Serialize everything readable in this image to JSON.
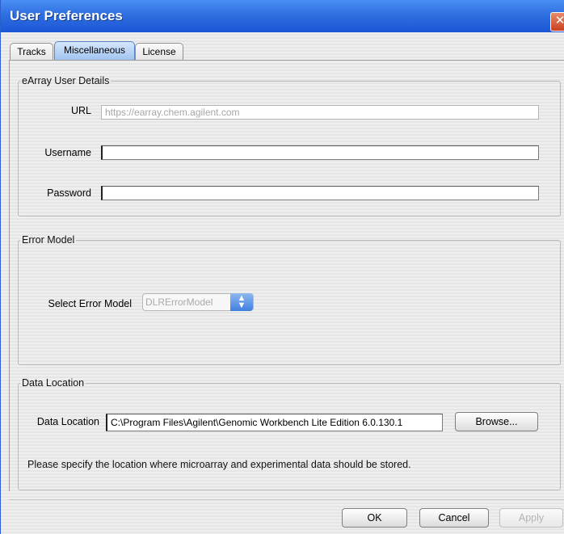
{
  "window": {
    "title": "User Preferences",
    "close_glyph": "✕"
  },
  "tabs": [
    {
      "label": "Tracks",
      "active": false
    },
    {
      "label": "Miscellaneous",
      "active": true
    },
    {
      "label": "License",
      "active": false
    }
  ],
  "user_details": {
    "legend": "eArray User Details",
    "url_label": "URL",
    "url_value": "https://earray.chem.agilent.com",
    "username_label": "Username",
    "username_value": "",
    "password_label": "Password",
    "password_value": ""
  },
  "error_model": {
    "legend": "Error Model",
    "select_label": "Select Error Model",
    "selected": "DLRErrorModel",
    "arrow_glyph": "▲\n▼"
  },
  "data_location": {
    "legend": "Data Location",
    "field_label": "Data Location",
    "path": "C:\\Program Files\\Agilent\\Genomic Workbench Lite Edition 6.0.130.1",
    "browse_label": "Browse...",
    "note": "Please specify the location where microarray and experimental data should be stored."
  },
  "footer": {
    "ok_label": "OK",
    "cancel_label": "Cancel",
    "apply_label": "Apply"
  },
  "colors": {
    "title_bar": "#2f6fe0",
    "close_button": "#c9401e",
    "tab_active": "#9fc2ef"
  }
}
